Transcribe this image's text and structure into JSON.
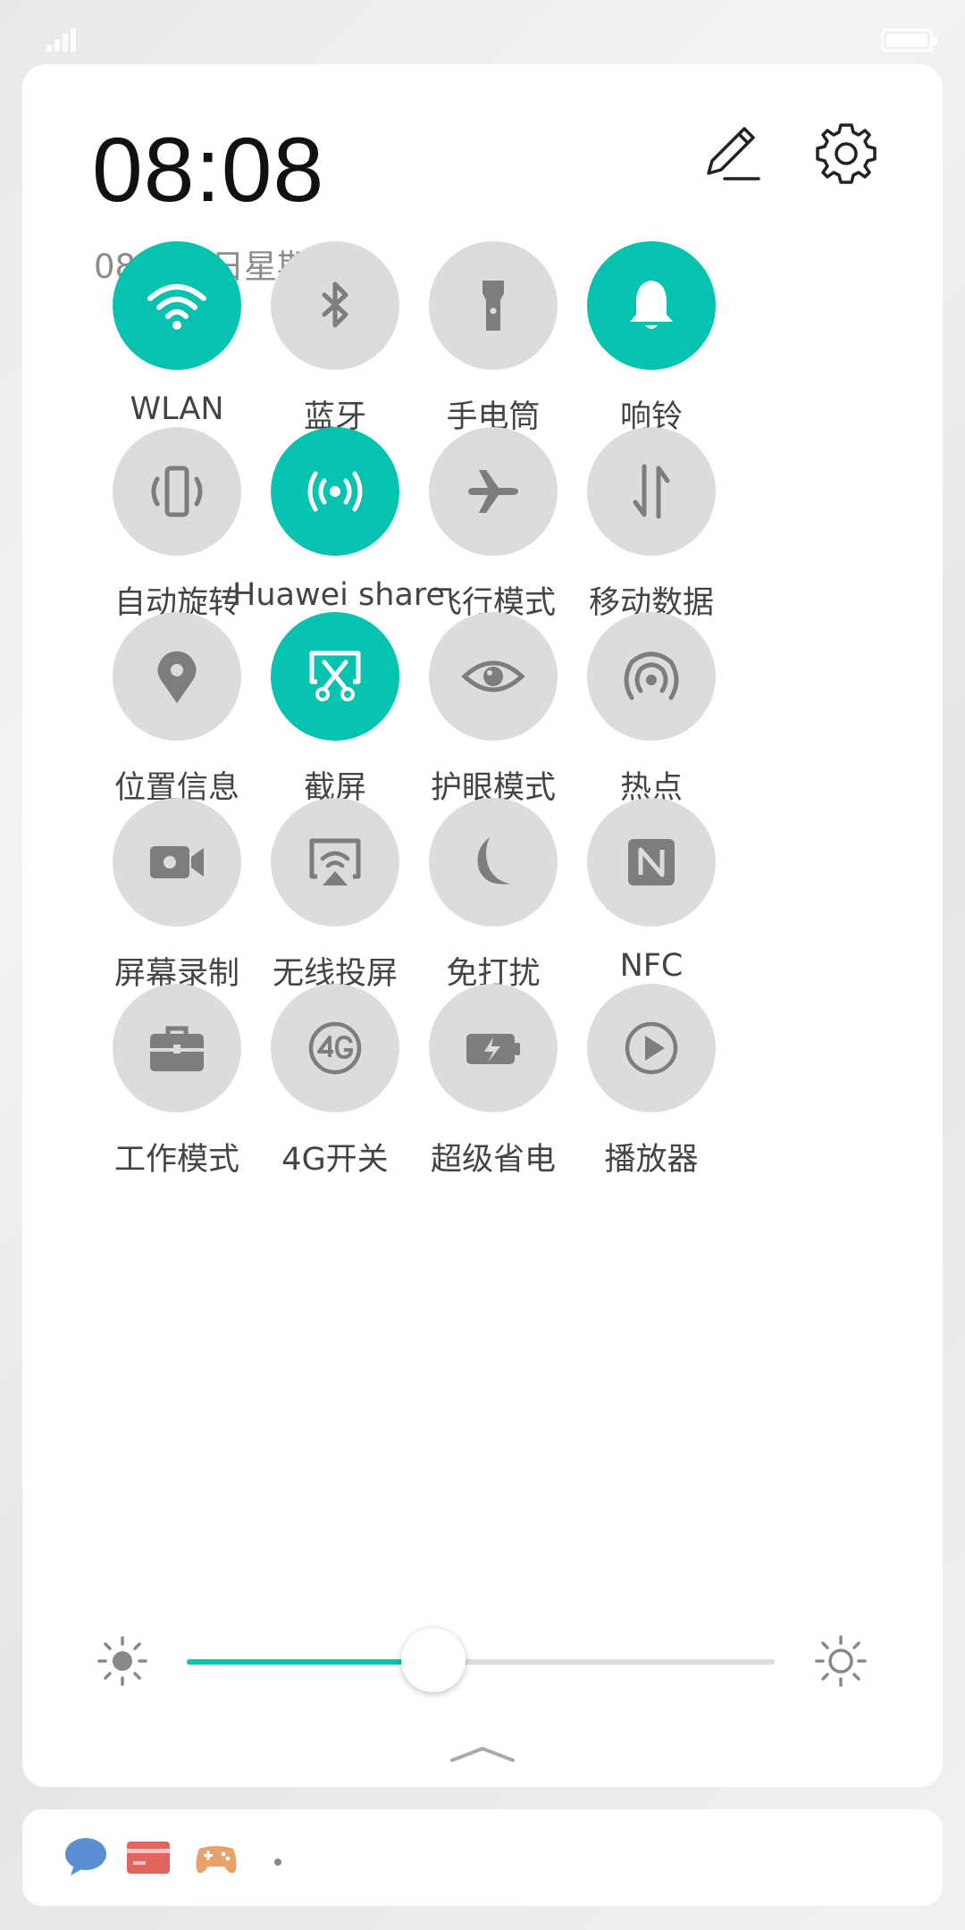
{
  "status_bar": {
    "signal_icon": "signal-icon",
    "battery_icon": "battery-icon"
  },
  "header": {
    "time": "08:08",
    "date": "08月02日星期五",
    "edit_icon": "edit-pencil-icon",
    "settings_icon": "gear-icon"
  },
  "colors": {
    "accent": "#05c3ae",
    "tile_off": "#dcdcdd",
    "icon_off": "#7d7d7d",
    "icon_on": "#ffffff"
  },
  "toggles": [
    {
      "label": "WLAN",
      "icon": "wifi-icon",
      "on": true
    },
    {
      "label": "蓝牙",
      "icon": "bluetooth-icon",
      "on": false
    },
    {
      "label": "手电筒",
      "icon": "flashlight-icon",
      "on": false
    },
    {
      "label": "响铃",
      "icon": "bell-icon",
      "on": true
    },
    {
      "label": "自动旋转",
      "icon": "auto-rotate-icon",
      "on": false
    },
    {
      "label": "Huawei share",
      "icon": "share-signal-icon",
      "on": true
    },
    {
      "label": "飞行模式",
      "icon": "airplane-icon",
      "on": false
    },
    {
      "label": "移动数据",
      "icon": "mobile-data-icon",
      "on": false
    },
    {
      "label": "位置信息",
      "icon": "location-pin-icon",
      "on": false
    },
    {
      "label": "截屏",
      "icon": "screenshot-scissors-icon",
      "on": true
    },
    {
      "label": "护眼模式",
      "icon": "eye-icon",
      "on": false
    },
    {
      "label": "热点",
      "icon": "hotspot-icon",
      "on": false
    },
    {
      "label": "屏幕录制",
      "icon": "screen-record-icon",
      "on": false
    },
    {
      "label": "无线投屏",
      "icon": "wireless-projection-icon",
      "on": false
    },
    {
      "label": "免打扰",
      "icon": "moon-icon",
      "on": false
    },
    {
      "label": "NFC",
      "icon": "nfc-icon",
      "on": false
    },
    {
      "label": "工作模式",
      "icon": "briefcase-icon",
      "on": false
    },
    {
      "label": "4G开关",
      "icon": "4g-icon",
      "on": false
    },
    {
      "label": "超级省电",
      "icon": "battery-saver-icon",
      "on": false
    },
    {
      "label": "播放器",
      "icon": "play-icon",
      "on": false
    }
  ],
  "brightness": {
    "level": 0.42,
    "low_icon": "brightness-low-icon",
    "high_icon": "brightness-high-icon"
  },
  "collapse_icon": "chevron-up-icon",
  "notifications": [
    {
      "icon": "message-bubble-icon",
      "color": "#5b8fd4"
    },
    {
      "icon": "wallet-card-icon",
      "color": "#e0655f"
    },
    {
      "icon": "game-controller-icon",
      "color": "#e6a26a"
    }
  ]
}
